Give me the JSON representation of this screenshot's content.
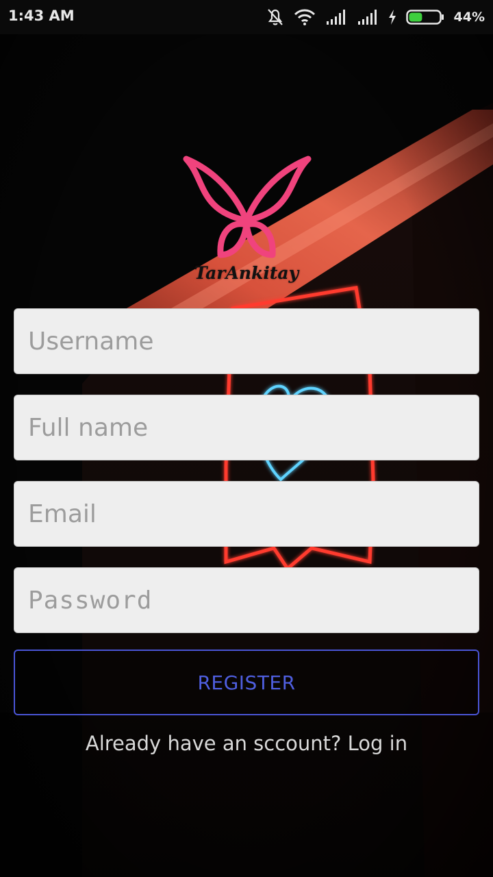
{
  "status_bar": {
    "time": "1:43 AM",
    "battery_percent": "44%",
    "battery_level": 0.44,
    "icons": [
      "mute-icon",
      "wifi-icon",
      "signal-icon",
      "signal-icon",
      "charging-icon",
      "battery-icon"
    ]
  },
  "logo": {
    "brand_text": "TarAnkitay",
    "color": "#f0437d"
  },
  "form": {
    "username_placeholder": "Username",
    "fullname_placeholder": "Full name",
    "email_placeholder": "Email",
    "password_placeholder": "Password",
    "register_label": "REGISTER",
    "login_prompt": "Already have an sccount? Log in"
  },
  "colors": {
    "accent": "#4a55d6",
    "neon_red": "#ff3b2f",
    "neon_blue": "#5fd3ff",
    "field_bg": "#eeeeee"
  }
}
